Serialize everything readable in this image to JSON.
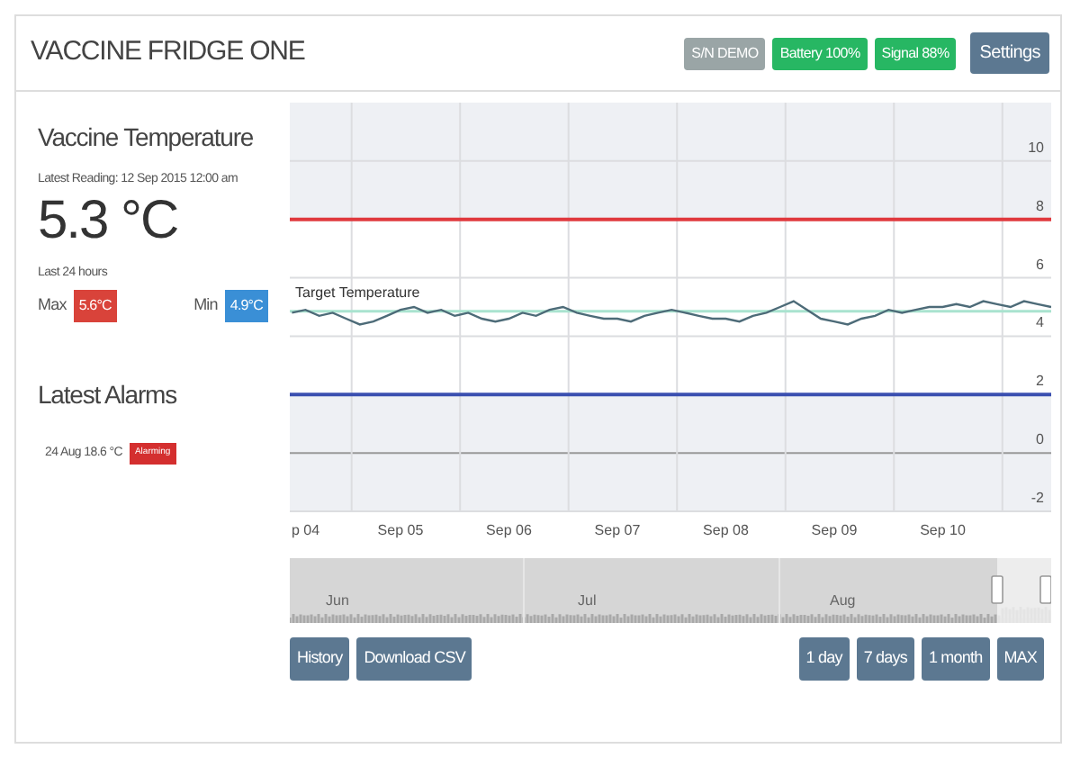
{
  "header": {
    "title": "VACCINE FRIDGE ONE",
    "badges": [
      {
        "text": "S/N DEMO",
        "color": "#9aa5a6"
      },
      {
        "text": "Battery 100%",
        "color": "#27b763"
      },
      {
        "text": "Signal 88%",
        "color": "#27b763"
      }
    ],
    "settings_button": "Settings"
  },
  "temperature": {
    "title": "Vaccine Temperature",
    "latest_reading": "Latest Reading: 12 Sep 2015 12:00 am",
    "value": "5.3 °C",
    "period": "Last 24 hours",
    "max_label": "Max",
    "max_value": "5.6°C",
    "min_label": "Min",
    "min_value": "4.9°C"
  },
  "alarms": {
    "title": "Latest Alarms",
    "items": [
      {
        "text": "24 Aug 18.6 °C",
        "status": "Alarming"
      }
    ]
  },
  "chart": {
    "cut_axis_label": "p 04",
    "chart_data": {
      "type": "line",
      "ylim": [
        -2,
        12
      ],
      "yticks": [
        -2,
        0,
        2,
        4,
        6,
        8,
        10
      ],
      "grid": true,
      "categories": [
        null,
        null,
        null,
        null,
        null,
        null,
        null,
        null,
        "Sep 05",
        null,
        null,
        null,
        null,
        null,
        null,
        null,
        "Sep 06",
        null,
        null,
        null,
        null,
        null,
        null,
        null,
        "Sep 07",
        null,
        null,
        null,
        null,
        null,
        null,
        null,
        "Sep 08",
        null,
        null,
        null,
        null,
        null,
        null,
        null,
        "Sep 09",
        null,
        null,
        null,
        null,
        null,
        null,
        null,
        "Sep 10",
        null,
        null,
        null,
        null,
        null,
        null,
        null,
        null
      ],
      "series": [
        {
          "color": "#4d6b78",
          "values": [
            4.8,
            4.9,
            4.7,
            4.8,
            4.6,
            4.4,
            4.5,
            4.7,
            4.9,
            5.0,
            4.8,
            4.9,
            4.7,
            4.8,
            4.6,
            4.5,
            4.6,
            4.8,
            4.7,
            4.9,
            5.0,
            4.8,
            4.7,
            4.6,
            4.6,
            4.5,
            4.7,
            4.8,
            4.9,
            4.8,
            4.7,
            4.6,
            4.6,
            4.5,
            4.7,
            4.8,
            5.0,
            5.2,
            4.9,
            4.6,
            4.5,
            4.4,
            4.6,
            4.7,
            4.9,
            4.8,
            4.9,
            5.0,
            5.0,
            5.1,
            5.0,
            5.2,
            5.1,
            5.0,
            5.2,
            5.1,
            5.0
          ]
        }
      ],
      "bands": [
        {
          "axis": "y",
          "from": 2,
          "to": 8,
          "color": "#ffffff"
        }
      ],
      "ref_lines": [
        {
          "axis": "y",
          "value": 8,
          "color": "#e0393e"
        },
        {
          "axis": "y",
          "value": 2,
          "color": "#3a4fb0"
        },
        {
          "axis": "y",
          "value": 4.85,
          "color": "#a9e3cf",
          "label": "Target Temperature"
        }
      ]
    },
    "navigator": {
      "months": [
        "Jun",
        "Jul",
        "Aug"
      ]
    }
  },
  "actions": [
    "History",
    "Download CSV"
  ],
  "ranges": [
    "1 day",
    "7 days",
    "1 month",
    "MAX"
  ]
}
